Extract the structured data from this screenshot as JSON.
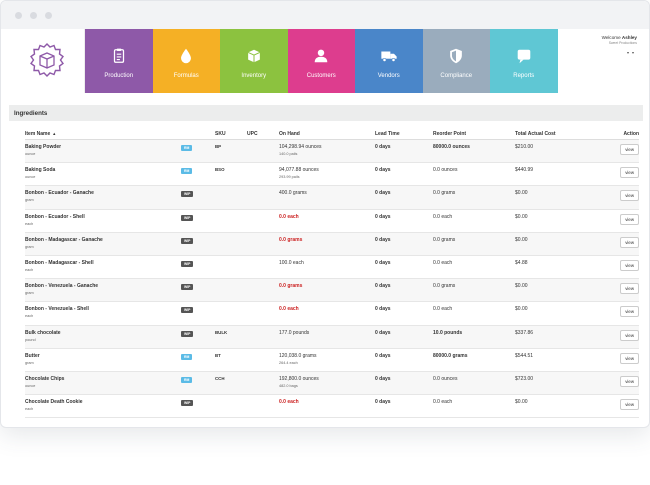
{
  "nav": {
    "tiles": [
      {
        "label": "Production",
        "icon": "clipboard-icon",
        "color": "#8e59a8"
      },
      {
        "label": "Formulas",
        "icon": "droplet-icon",
        "color": "#f5b025"
      },
      {
        "label": "Inventory",
        "icon": "box-icon",
        "color": "#8cc23f"
      },
      {
        "label": "Customers",
        "icon": "person-icon",
        "color": "#dd3d8e"
      },
      {
        "label": "Vendors",
        "icon": "truck-icon",
        "color": "#4a86c9"
      },
      {
        "label": "Compliance",
        "icon": "shield-icon",
        "color": "#9aacbd"
      },
      {
        "label": "Reports",
        "icon": "chat-icon",
        "color": "#5fc7d4"
      }
    ],
    "welcome_prefix": "Welcome",
    "user_name": "Ashley",
    "org_line": "Sweet Productions"
  },
  "section": {
    "title": "Ingredients"
  },
  "table": {
    "headers": {
      "name": "Item Name",
      "sku": "SKU",
      "upc": "UPC",
      "on_hand": "On Hand",
      "lead": "Lead Time",
      "reorder": "Reorder Point",
      "cost": "Total Actual Cost",
      "action": "Action"
    },
    "rows": [
      {
        "name": "Baking Powder",
        "unit": "ounce",
        "tag": "RM",
        "sku": "BP",
        "on_hand": "104,298.94 ounces",
        "on_hand_sub": "140.0 pails",
        "on_hand_red": false,
        "lead": "0 days",
        "reorder": "80000.0 ounces",
        "reorder_bold": true,
        "cost": "$210.00",
        "action": "view"
      },
      {
        "name": "Baking Soda",
        "unit": "ounce",
        "tag": "RM",
        "sku": "BSO",
        "on_hand": "94,077.88 ounces",
        "on_hand_sub": "293.99 pails",
        "on_hand_red": false,
        "lead": "0 days",
        "reorder": "0.0 ounces",
        "reorder_bold": false,
        "cost": "$440.99",
        "action": "view"
      },
      {
        "name": "Bonbon - Ecuador - Ganache",
        "unit": "gram",
        "tag": "WIP",
        "sku": "",
        "on_hand": "400.0 grams",
        "on_hand_sub": "",
        "on_hand_red": false,
        "lead": "0 days",
        "reorder": "0.0 grams",
        "reorder_bold": false,
        "cost": "$0.00",
        "action": "view"
      },
      {
        "name": "Bonbon - Ecuador - Shell",
        "unit": "each",
        "tag": "WIP",
        "sku": "",
        "on_hand": "0.0 each",
        "on_hand_sub": "",
        "on_hand_red": true,
        "lead": "0 days",
        "reorder": "0.0 each",
        "reorder_bold": false,
        "cost": "$0.00",
        "action": "view"
      },
      {
        "name": "Bonbon - Madagascar - Ganache",
        "unit": "gram",
        "tag": "WIP",
        "sku": "",
        "on_hand": "0.0 grams",
        "on_hand_sub": "",
        "on_hand_red": true,
        "lead": "0 days",
        "reorder": "0.0 grams",
        "reorder_bold": false,
        "cost": "$0.00",
        "action": "view"
      },
      {
        "name": "Bonbon - Madagascar - Shell",
        "unit": "each",
        "tag": "WIP",
        "sku": "",
        "on_hand": "100.0 each",
        "on_hand_sub": "",
        "on_hand_red": false,
        "lead": "0 days",
        "reorder": "0.0 each",
        "reorder_bold": false,
        "cost": "$4.88",
        "action": "view"
      },
      {
        "name": "Bonbon - Venezuela - Ganache",
        "unit": "gram",
        "tag": "WIP",
        "sku": "",
        "on_hand": "0.0 grams",
        "on_hand_sub": "",
        "on_hand_red": true,
        "lead": "0 days",
        "reorder": "0.0 grams",
        "reorder_bold": false,
        "cost": "$0.00",
        "action": "view"
      },
      {
        "name": "Bonbon - Venezuela - Shell",
        "unit": "each",
        "tag": "WIP",
        "sku": "",
        "on_hand": "0.0 each",
        "on_hand_sub": "",
        "on_hand_red": true,
        "lead": "0 days",
        "reorder": "0.0 each",
        "reorder_bold": false,
        "cost": "$0.00",
        "action": "view"
      },
      {
        "name": "Bulk chocolate",
        "unit": "pound",
        "tag": "WIP",
        "sku": "BULK",
        "on_hand": "177.0 pounds",
        "on_hand_sub": "",
        "on_hand_red": false,
        "lead": "0 days",
        "reorder": "10.0 pounds",
        "reorder_bold": true,
        "cost": "$337.86",
        "action": "view"
      },
      {
        "name": "Butter",
        "unit": "gram",
        "tag": "RM",
        "sku": "BT",
        "on_hand": "120,038.0 grams",
        "on_hand_sub": "264.4 each",
        "on_hand_red": false,
        "lead": "0 days",
        "reorder": "80000.0 grams",
        "reorder_bold": true,
        "cost": "$544.51",
        "action": "view"
      },
      {
        "name": "Chocolate Chips",
        "unit": "ounce",
        "tag": "RM",
        "sku": "CCH",
        "on_hand": "192,800.0 ounces",
        "on_hand_sub": "482.0 bags",
        "on_hand_red": false,
        "lead": "0 days",
        "reorder": "0.0 ounces",
        "reorder_bold": false,
        "cost": "$723.00",
        "action": "view"
      },
      {
        "name": "Chocolate Death Cookie",
        "unit": "each",
        "tag": "WIP",
        "sku": "",
        "on_hand": "0.0 each",
        "on_hand_sub": "",
        "on_hand_red": true,
        "lead": "0 days",
        "reorder": "0.0 each",
        "reorder_bold": false,
        "cost": "$0.00",
        "action": "view"
      }
    ]
  }
}
